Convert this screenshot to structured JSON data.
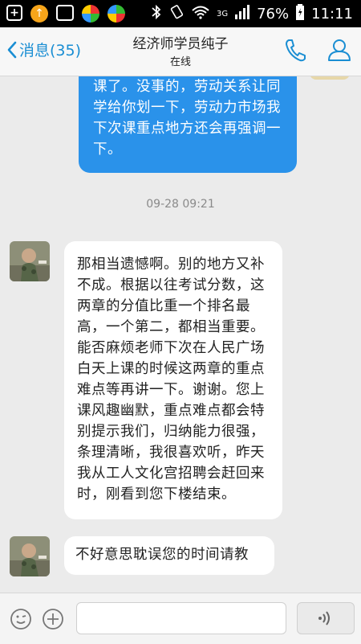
{
  "status_bar": {
    "battery": "76%",
    "time": "11:11",
    "network": "3G"
  },
  "header": {
    "back_label": "消息(35)",
    "title": "经济师学员纯子",
    "subtitle": "在线"
  },
  "messages": {
    "sent_text": "课了。没事的，劳动关系让同学给你划一下，劳动力市场我下次课重点地方还会再强调一下。",
    "timestamp": "09-28 09:21",
    "received_1": "那相当遗憾啊。别的地方又补不成。根据以往考试分数，这两章的分值比重一个排名最高，一个第二，都相当重要。能否麻烦老师下次在人民广场白天上课的时候这两章的重点难点等再讲一下。谢谢。您上课风趣幽默，重点难点都会特别提示我们，归纳能力很强，条理清晰，我很喜欢听，昨天我从工人文化宫招聘会赶回来时，刚看到您下楼结束。",
    "received_2": "不好意思耽误您的时间请教"
  },
  "colors": {
    "accent": "#1a8ed3",
    "sent_bubble": "#2a92ea",
    "background": "#ebebeb"
  }
}
